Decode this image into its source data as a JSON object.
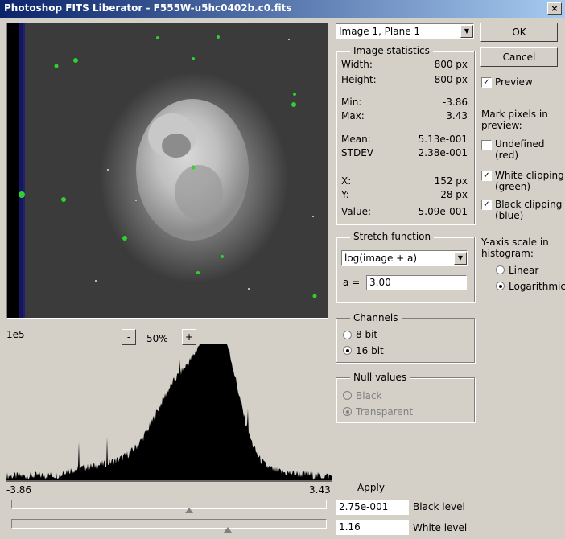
{
  "window": {
    "title": "Photoshop FITS Liberator - F555W-u5hc0402b.c0.fits",
    "close": "×"
  },
  "preview": {
    "zoom_minus": "-",
    "zoom_label": "50%",
    "zoom_plus": "+"
  },
  "histogram": {
    "y_label": "1e5",
    "x_min": "-3.86",
    "x_max": "3.43"
  },
  "image_select": {
    "value": "Image 1, Plane 1"
  },
  "stats": {
    "legend": "Image statistics",
    "width_label": "Width:",
    "width": "800 px",
    "height_label": "Height:",
    "height": "800 px",
    "min_label": "Min:",
    "min": "-3.86",
    "max_label": "Max:",
    "max": "3.43",
    "mean_label": "Mean:",
    "mean": "5.13e-001",
    "stdev_label": "STDEV",
    "stdev": "2.38e-001",
    "x_label": "X:",
    "x": "152 px",
    "y_label": "Y:",
    "y": "28 px",
    "value_label": "Value:",
    "value": "5.09e-001"
  },
  "stretch": {
    "legend": "Stretch function",
    "function": "log(image + a)",
    "a_label": "a =",
    "a_value": "3.00"
  },
  "channels": {
    "legend": "Channels",
    "opt8": "8 bit",
    "opt16": "16 bit"
  },
  "nullvals": {
    "legend": "Null values",
    "black": "Black",
    "transparent": "Transparent"
  },
  "buttons": {
    "ok": "OK",
    "cancel": "Cancel",
    "apply": "Apply"
  },
  "options": {
    "preview": "Preview",
    "mark_l1": "Mark pixels in",
    "mark_l2": "preview:",
    "undef_l1": "Undefined",
    "undef_l2": "(red)",
    "white_l1": "White clipping",
    "white_l2": "(green)",
    "black_l1": "Black clipping",
    "black_l2": "(blue)",
    "yaxis_l1": "Y-axis scale in",
    "yaxis_l2": "histogram:",
    "linear": "Linear",
    "log": "Logarithmic"
  },
  "levels": {
    "black_value": "2.75e-001",
    "black_label": "Black level",
    "white_value": "1.16",
    "white_label": "White level",
    "black_fraction": 0.57,
    "white_fraction": 0.69
  }
}
